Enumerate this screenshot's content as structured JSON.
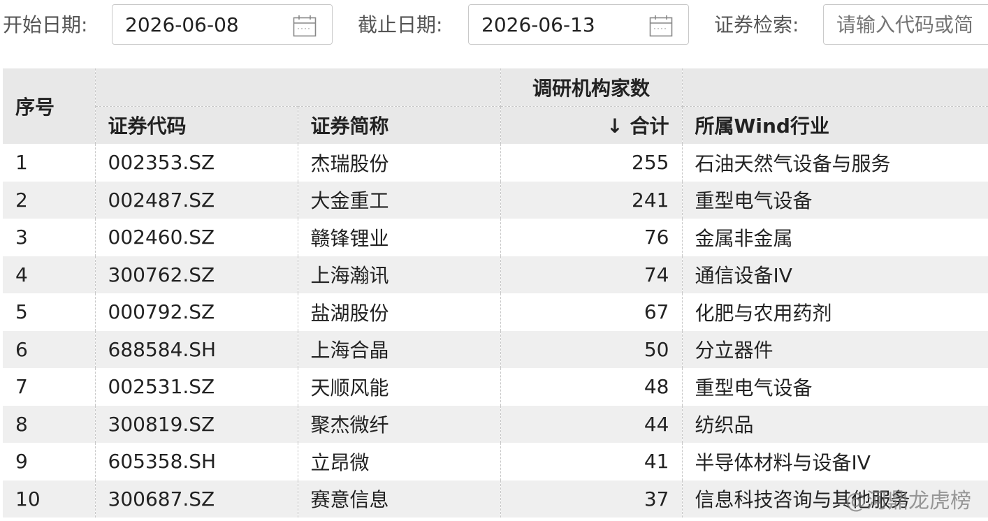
{
  "filters": {
    "start_label": "开始日期:",
    "start_value": "2026-06-08",
    "end_label": "截止日期:",
    "end_value": "2026-06-13",
    "search_label": "证券检索:",
    "search_placeholder": "请输入代码或简"
  },
  "table": {
    "group_header": "调研机构家数",
    "columns": {
      "index": "序号",
      "code": "证券代码",
      "name": "证券简称",
      "total": "↓ 合计",
      "industry": "所属Wind行业"
    },
    "rows": [
      {
        "index": "1",
        "code": "002353.SZ",
        "name": "杰瑞股份",
        "total": "255",
        "industry": "石油天然气设备与服务"
      },
      {
        "index": "2",
        "code": "002487.SZ",
        "name": "大金重工",
        "total": "241",
        "industry": "重型电气设备"
      },
      {
        "index": "3",
        "code": "002460.SZ",
        "name": "赣锋锂业",
        "total": "76",
        "industry": "金属非金属"
      },
      {
        "index": "4",
        "code": "300762.SZ",
        "name": "上海瀚讯",
        "total": "74",
        "industry": "通信设备IV"
      },
      {
        "index": "5",
        "code": "000792.SZ",
        "name": "盐湖股份",
        "total": "67",
        "industry": "化肥与农用药剂"
      },
      {
        "index": "6",
        "code": "688584.SH",
        "name": "上海合晶",
        "total": "50",
        "industry": "分立器件"
      },
      {
        "index": "7",
        "code": "002531.SZ",
        "name": "天顺风能",
        "total": "48",
        "industry": "重型电气设备"
      },
      {
        "index": "8",
        "code": "300819.SZ",
        "name": "聚杰微纤",
        "total": "44",
        "industry": "纺织品"
      },
      {
        "index": "9",
        "code": "605358.SH",
        "name": "立昂微",
        "total": "41",
        "industry": "半导体材料与设备IV"
      },
      {
        "index": "10",
        "code": "300687.SZ",
        "name": "赛意信息",
        "total": "37",
        "industry": "信息科技咨询与其他服务"
      }
    ]
  },
  "watermark": "@河鼎龙虎榜"
}
